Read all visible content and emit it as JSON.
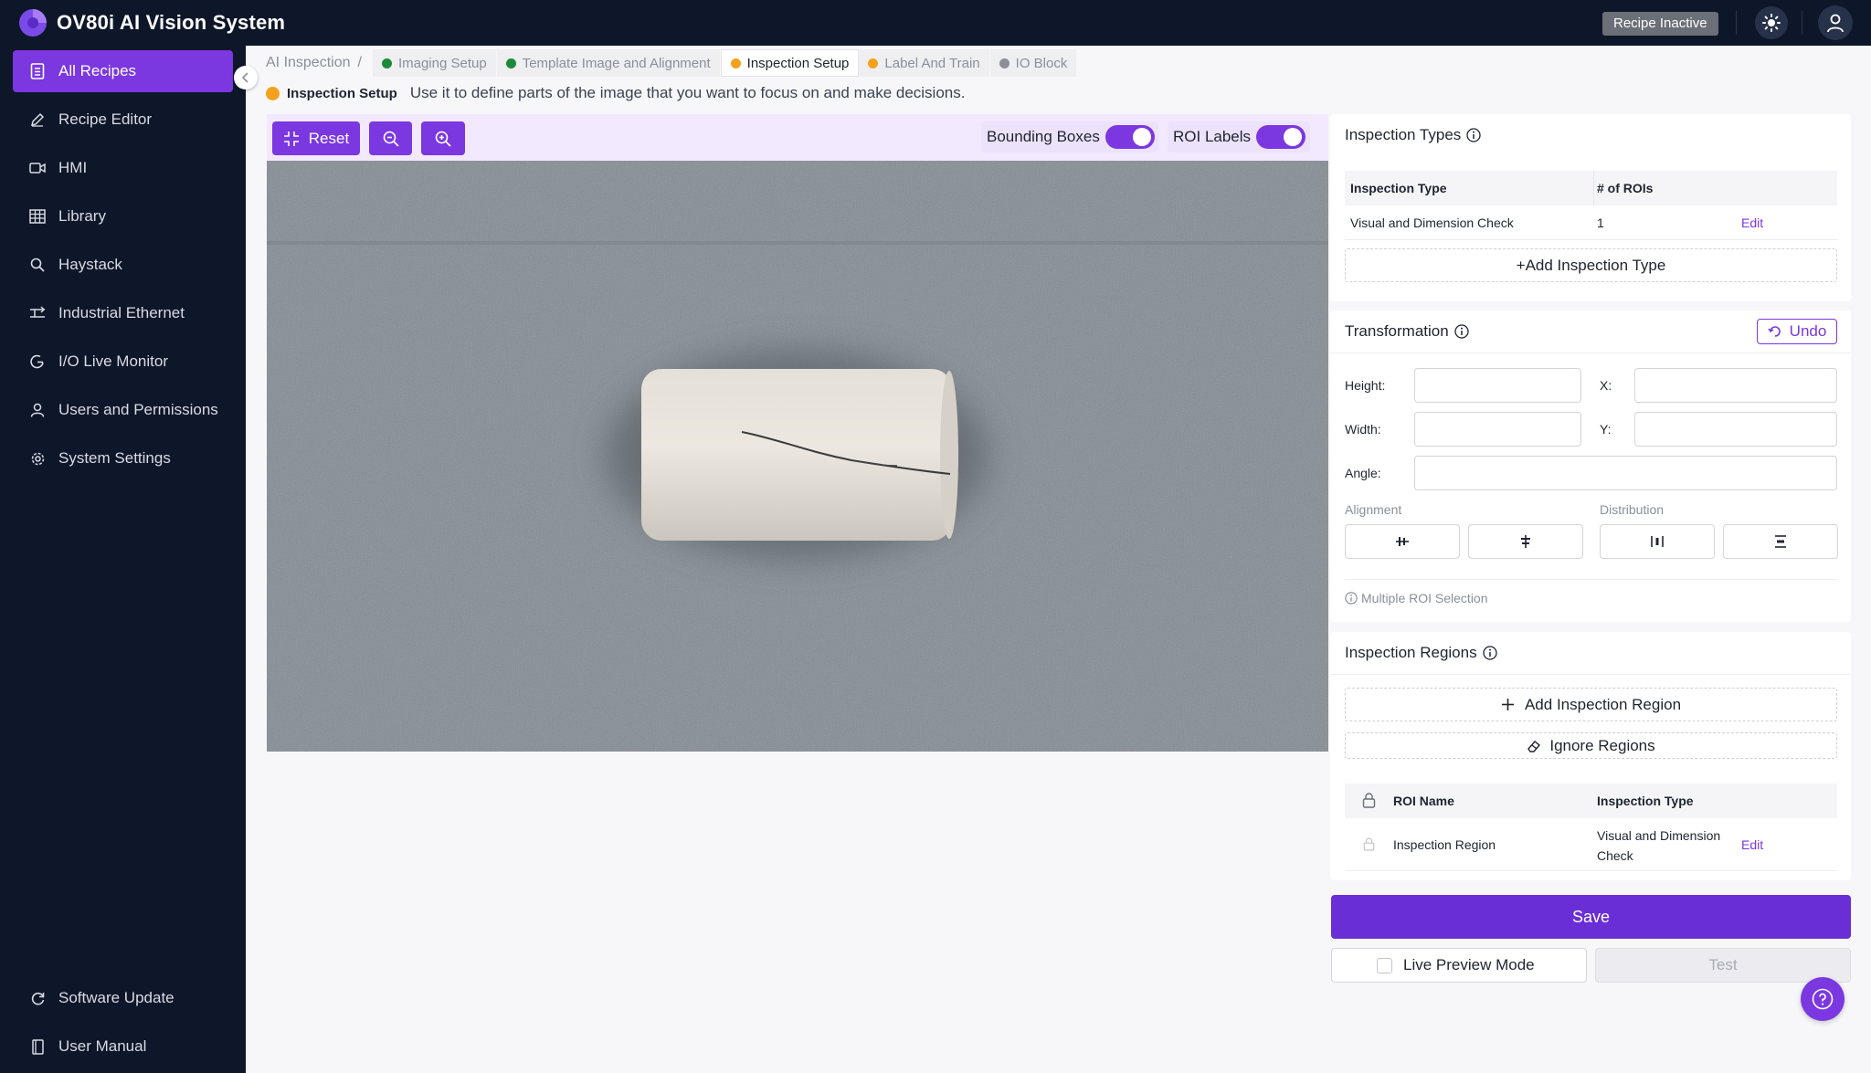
{
  "app": {
    "title": "OV80i AI Vision System",
    "status_badge": "Recipe Inactive"
  },
  "sidebar": {
    "items": [
      {
        "label": "All Recipes",
        "icon": "document-list-icon"
      },
      {
        "label": "Recipe Editor",
        "icon": "pencil-icon"
      },
      {
        "label": "HMI",
        "icon": "video-icon"
      },
      {
        "label": "Library",
        "icon": "grid-table-icon"
      },
      {
        "label": "Haystack",
        "icon": "search-icon"
      },
      {
        "label": "Industrial Ethernet",
        "icon": "network-icon"
      },
      {
        "label": "I/O Live Monitor",
        "icon": "gauge-icon"
      },
      {
        "label": "Users and Permissions",
        "icon": "user-icon"
      },
      {
        "label": "System Settings",
        "icon": "gear-icon"
      }
    ],
    "bottom": [
      {
        "label": "Software Update",
        "icon": "refresh-icon"
      },
      {
        "label": "User Manual",
        "icon": "book-icon"
      }
    ]
  },
  "breadcrumb": {
    "root": "AI Inspection",
    "separator": "/",
    "steps": [
      {
        "label": "Imaging Setup",
        "status": "green"
      },
      {
        "label": "Template Image and Alignment",
        "status": "green"
      },
      {
        "label": "Inspection Setup",
        "status": "orange"
      },
      {
        "label": "Label And Train",
        "status": "orange"
      },
      {
        "label": "IO Block",
        "status": "gray"
      }
    ]
  },
  "step_info": {
    "label": "Inspection Setup",
    "text": "Use it to define parts of the image that you want to focus on and make decisions."
  },
  "toolbar": {
    "reset_label": "Reset",
    "bounding_boxes_label": "Bounding Boxes",
    "bounding_boxes_on": true,
    "roi_labels_label": "ROI Labels",
    "roi_labels_on": true
  },
  "inspection_types": {
    "title": "Inspection Types",
    "headers": [
      "Inspection Type",
      "# of ROIs"
    ],
    "rows": [
      {
        "type": "Visual and Dimension Check",
        "rois": "1",
        "action": "Edit"
      }
    ],
    "add_label": "+Add Inspection Type"
  },
  "transformation": {
    "title": "Transformation",
    "undo_label": "Undo",
    "height_label": "Height:",
    "width_label": "Width:",
    "x_label": "X:",
    "y_label": "Y:",
    "angle_label": "Angle:",
    "height": "",
    "width": "",
    "x": "",
    "y": "",
    "angle": "",
    "alignment_label": "Alignment",
    "distribution_label": "Distribution",
    "multi_note": "Multiple ROI Selection"
  },
  "inspection_regions": {
    "title": "Inspection Regions",
    "add_label": "Add Inspection Region",
    "ignore_label": "Ignore Regions",
    "headers": [
      "ROI Name",
      "Inspection Type"
    ],
    "rows": [
      {
        "name": "Inspection Region",
        "type_line1": "Visual and Dimension",
        "type_line2": "Check",
        "action": "Edit"
      }
    ]
  },
  "actions": {
    "save_label": "Save",
    "live_preview_label": "Live Preview Mode",
    "test_label": "Test"
  },
  "colors": {
    "accent": "#7b37e0",
    "navy": "#0e1729",
    "green": "#1d8a3a",
    "orange": "#f4a21c"
  }
}
